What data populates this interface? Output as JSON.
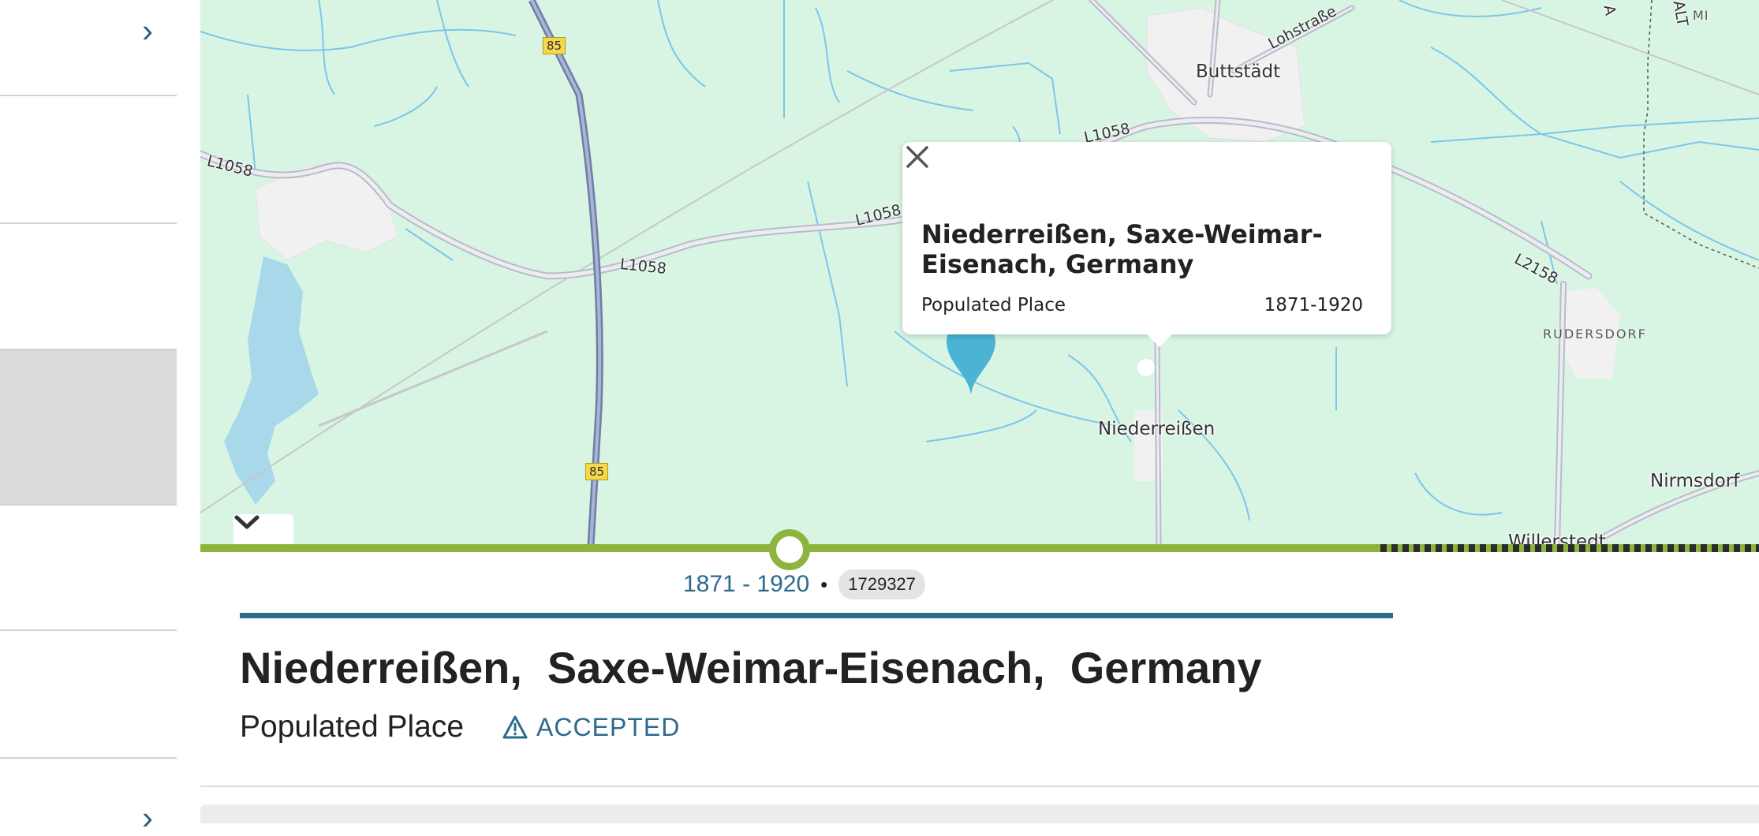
{
  "sidebar": {
    "chevron_top": "›",
    "chevron_bottom": "›"
  },
  "map": {
    "labels": {
      "buttstadt": "Buttstädt",
      "niederreissen": "Niederreißen",
      "nirmsdorf": "Nirmsdorf",
      "willerstedt": "Willerstedt",
      "rudersdorf": "RUDERSDORF",
      "lohstrasse": "Lohstraße",
      "mi": "MI",
      "alt": "ALT",
      "a": "A"
    },
    "roads": {
      "l1058_a": "L1058",
      "l1058_b": "L1058",
      "l1058_c": "L1058",
      "l1058_d": "L1058",
      "l2158": "L2158",
      "b85_top": "85",
      "b85_bottom": "85"
    },
    "popup": {
      "title": "Niederreißen, Saxe-Weimar-Eisenach, Germany",
      "type": "Populated Place",
      "years": "1871-1920"
    },
    "marker_color": "#4bb3d4"
  },
  "timeline": {
    "track_color": "#8db43c",
    "range": "1871 - 1920",
    "separator": "•",
    "id": "1729327"
  },
  "place": {
    "name_parts": [
      "Niederreißen,",
      "Saxe-Weimar-Eisenach,",
      "Germany"
    ],
    "type": "Populated Place",
    "status": "ACCEPTED"
  },
  "colors": {
    "accent": "#2c6a8e",
    "timeline": "#8db43c",
    "map_bg": "#d8f5e4"
  }
}
